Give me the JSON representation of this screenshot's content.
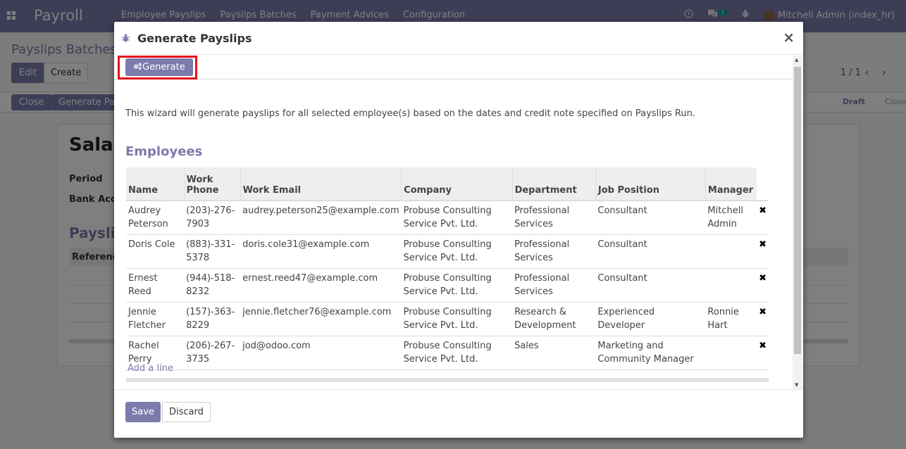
{
  "app": {
    "brand": "Payroll",
    "menu": [
      "Employee Payslips",
      "Payslips Batches",
      "Payment Advices",
      "Configuration"
    ],
    "messages_badge": "2",
    "user": "Mitchell Admin (index_hr)"
  },
  "background": {
    "breadcrumb": "Payslips Batches /",
    "edit_label": "Edit",
    "create_label": "Create",
    "pager": "1 / 1",
    "close_label": "Close",
    "generate_payslips_label": "Generate Payslips",
    "stages": [
      "Draft",
      "Close"
    ],
    "sheet_title": "Salar",
    "period_label": "Period",
    "bank_label": "Bank Acco",
    "payslips_label": "Payslip",
    "reference_label": "Referenc"
  },
  "modal": {
    "title": "Generate Payslips",
    "close_symbol": "×",
    "generate_label": "Generate",
    "description": "This wizard will generate payslips for all selected employee(s) based on the dates and credit note specified on Payslips Run.",
    "section_title": "Employees",
    "columns": [
      "Name",
      "Work Phone",
      "Work Email",
      "Company",
      "Department",
      "Job Position",
      "Manager"
    ],
    "employees": [
      {
        "name": "Audrey Peterson",
        "phone": "(203)-276-7903",
        "email": "audrey.peterson25@example.com",
        "company": "Probuse Consulting Service Pvt. Ltd.",
        "department": "Professional Services",
        "job": "Consultant",
        "manager": "Mitchell Admin"
      },
      {
        "name": "Doris Cole",
        "phone": "(883)-331-5378",
        "email": "doris.cole31@example.com",
        "company": "Probuse Consulting Service Pvt. Ltd.",
        "department": "Professional Services",
        "job": "Consultant",
        "manager": ""
      },
      {
        "name": "Ernest Reed",
        "phone": "(944)-518-8232",
        "email": "ernest.reed47@example.com",
        "company": "Probuse Consulting Service Pvt. Ltd.",
        "department": "Professional Services",
        "job": "Consultant",
        "manager": ""
      },
      {
        "name": "Jennie Fletcher",
        "phone": "(157)-363-8229",
        "email": "jennie.fletcher76@example.com",
        "company": "Probuse Consulting Service Pvt. Ltd.",
        "department": "Research & Development",
        "job": "Experienced Developer",
        "manager": "Ronnie Hart"
      },
      {
        "name": "Rachel Perry",
        "phone": "(206)-267-3735",
        "email": "jod@odoo.com",
        "company": "Probuse Consulting Service Pvt. Ltd.",
        "department": "Sales",
        "job": "Marketing and Community Manager",
        "manager": ""
      }
    ],
    "delete_symbol": "✖",
    "add_line_label": "Add a line",
    "save_label": "Save",
    "discard_label": "Discard"
  },
  "colors": {
    "brand": "#7c7bad",
    "highlight": "#e3141b"
  }
}
